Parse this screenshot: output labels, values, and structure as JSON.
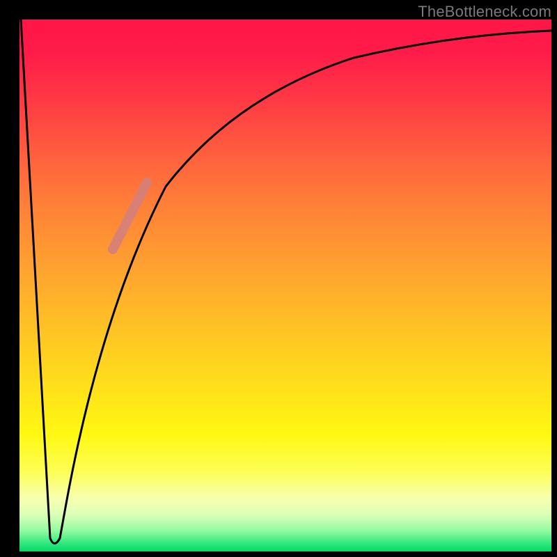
{
  "attribution": "TheBottleneck.com",
  "colors": {
    "background": "#000000",
    "curve": "#000000",
    "highlight": "#d58079",
    "gradient_top": "#ff1647",
    "gradient_bottom": "#08d769"
  },
  "chart_data": {
    "type": "line",
    "title": "",
    "xlabel": "",
    "ylabel": "",
    "xlim": [
      0,
      100
    ],
    "ylim": [
      0,
      100
    ],
    "grid": false,
    "annotations": [
      "TheBottleneck.com"
    ],
    "series": [
      {
        "name": "left-branch",
        "x": [
          0,
          1,
          2,
          3,
          4,
          5,
          5.5,
          6
        ],
        "y": [
          100,
          83,
          66,
          49,
          32,
          15,
          6,
          2
        ]
      },
      {
        "name": "right-branch",
        "x": [
          7,
          8,
          10,
          12,
          15,
          18,
          22,
          26,
          30,
          35,
          42,
          50,
          60,
          72,
          85,
          100
        ],
        "y": [
          2,
          10,
          26,
          38,
          50,
          59,
          67,
          73,
          78,
          82,
          86,
          89,
          91.5,
          93.5,
          95,
          96
        ]
      },
      {
        "name": "highlight-segment",
        "x": [
          17.5,
          23.5
        ],
        "y": [
          57,
          69
        ]
      }
    ],
    "notes": "Bottleneck-style chart: black V-curve over vertical red→green gradient; a short salmon highlight overlays the rising branch around x≈17–24."
  }
}
